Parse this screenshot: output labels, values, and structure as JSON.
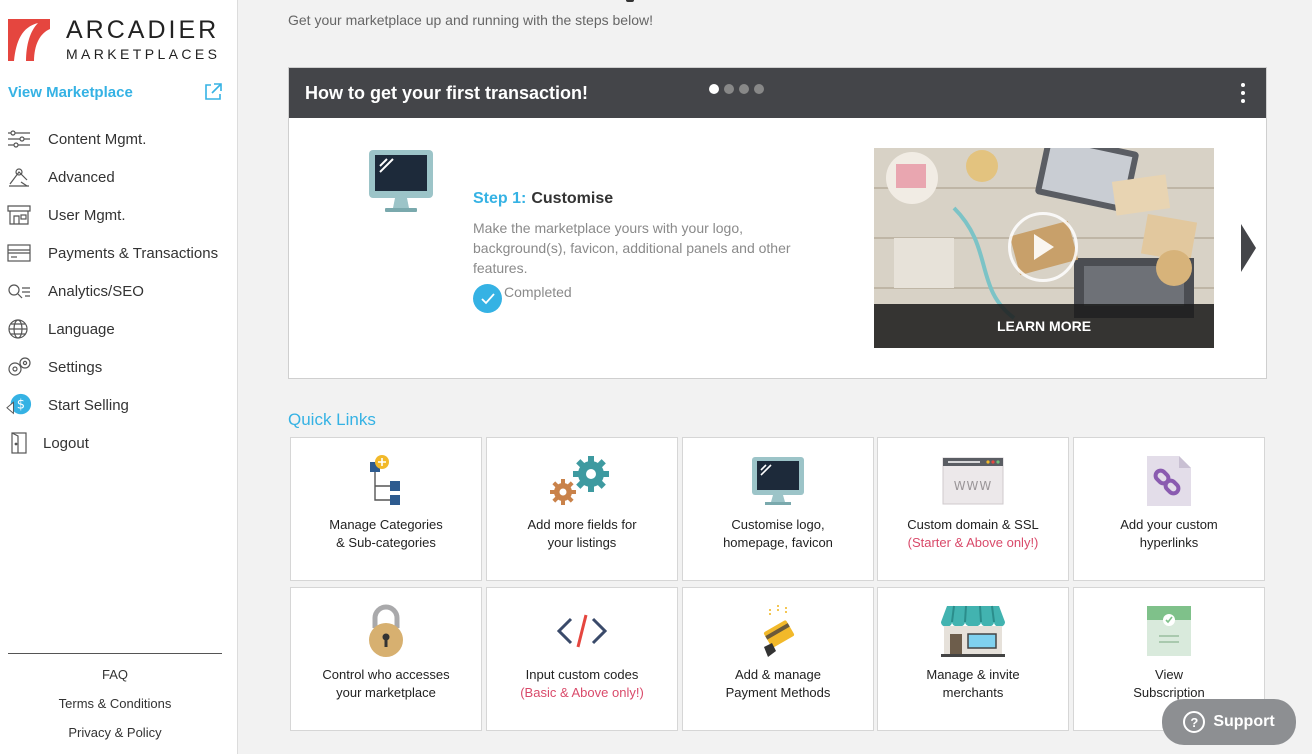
{
  "brand": {
    "line1": "ARCADIER",
    "line2": "MARKETPLACES"
  },
  "sidebar": {
    "view_marketplace": "View Marketplace",
    "items": [
      {
        "label": "Content Mgmt.",
        "icon": "sliders-icon"
      },
      {
        "label": "Advanced",
        "icon": "advanced-icon"
      },
      {
        "label": "User Mgmt.",
        "icon": "store-icon"
      },
      {
        "label": "Payments & Transactions",
        "icon": "card-icon"
      },
      {
        "label": "Analytics/SEO",
        "icon": "search-icon"
      },
      {
        "label": "Language",
        "icon": "globe-icon"
      },
      {
        "label": "Settings",
        "icon": "gear-icon"
      },
      {
        "label": "Start Selling",
        "icon": "dollar-icon"
      },
      {
        "label": "Logout",
        "icon": "logout-icon"
      }
    ],
    "footer": [
      "FAQ",
      "Terms & Conditions",
      "Privacy & Policy"
    ]
  },
  "main": {
    "subtitle": "Get your marketplace up and running with the steps below!",
    "card": {
      "title": "How to get your first transaction!",
      "dots_total": 4,
      "dots_active": 1,
      "step_number": "Step 1:",
      "step_title": "Customise",
      "step_desc": "Make the marketplace yours with your logo, background(s), favicon, additional panels and other features.",
      "step_status": "Completed",
      "learn_more": "LEARN MORE"
    },
    "quick_links_title": "Quick Links",
    "quick_links": [
      {
        "line1": "Manage Categories",
        "line2": "& Sub-categories",
        "note": "",
        "icon": "category-tree-icon"
      },
      {
        "line1": "Add more fields for",
        "line2": "your listings",
        "note": "",
        "icon": "gears-icon"
      },
      {
        "line1": "Customise logo,",
        "line2": "homepage, favicon",
        "note": "",
        "icon": "monitor-icon"
      },
      {
        "line1": "Custom domain & SSL",
        "line2": "",
        "note": "(Starter & Above only!)",
        "icon": "browser-www-icon"
      },
      {
        "line1": "Add your custom",
        "line2": "hyperlinks",
        "note": "",
        "icon": "link-file-icon"
      },
      {
        "line1": "Control who accesses",
        "line2": "your marketplace",
        "note": "",
        "icon": "padlock-icon"
      },
      {
        "line1": "Input custom codes",
        "line2": "",
        "note": "(Basic & Above only!)",
        "icon": "code-icon"
      },
      {
        "line1": "Add & manage",
        "line2": "Payment Methods",
        "note": "",
        "icon": "credit-card-icon"
      },
      {
        "line1": "Manage & invite",
        "line2": "merchants",
        "note": "",
        "icon": "storefront-icon"
      },
      {
        "line1": "View",
        "line2": "Subscription",
        "note": "",
        "icon": "subscription-icon"
      }
    ],
    "support": "Support"
  },
  "colors": {
    "accent": "#35b2e4",
    "brand": "#e5463f",
    "header": "#444549",
    "note": "#d94a6a"
  }
}
